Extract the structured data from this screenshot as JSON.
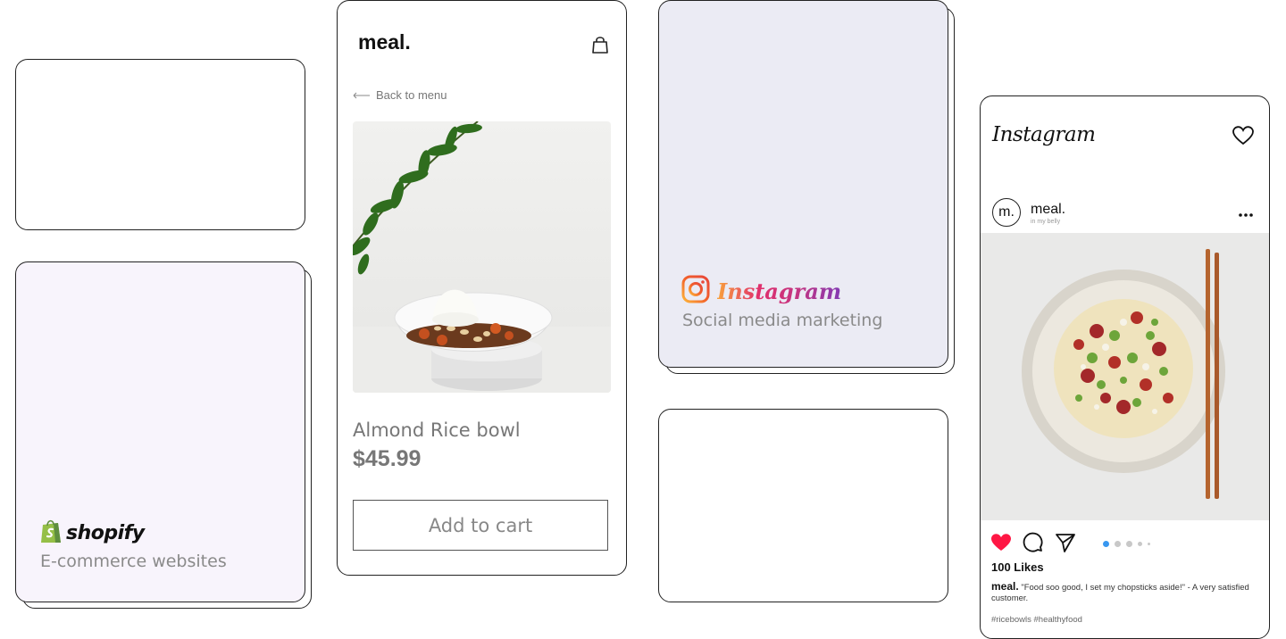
{
  "shopify_card": {
    "logo_text": "shopify",
    "caption": "E-commerce websites",
    "icon": "shopify-bag-icon",
    "bg_color": "#f8f4fc"
  },
  "product_card": {
    "brand": "meal.",
    "cart_icon": "shopping-bag-icon",
    "back_label": "Back to menu",
    "product_name": "Almond Rice bowl",
    "price": "$45.99",
    "add_to_cart_label": "Add to cart"
  },
  "instagram_card": {
    "logo_text": "Instagram",
    "caption": "Social media marketing",
    "icon": "instagram-camera-icon",
    "bg_color": "#ebebf4"
  },
  "instagram_post": {
    "app_title": "Instagram",
    "avatar_text": "m.",
    "username": "meal.",
    "user_subtitle": "in my belly",
    "likes": "100 Likes",
    "caption_user": "meal.",
    "caption_text": "\"Food soo good, I set my chopsticks aside!\" - A very satisfied customer.",
    "hashtags": "#ricebowls #healthyfood",
    "like_color": "#ff1744",
    "active_dot_color": "#3897f0"
  }
}
